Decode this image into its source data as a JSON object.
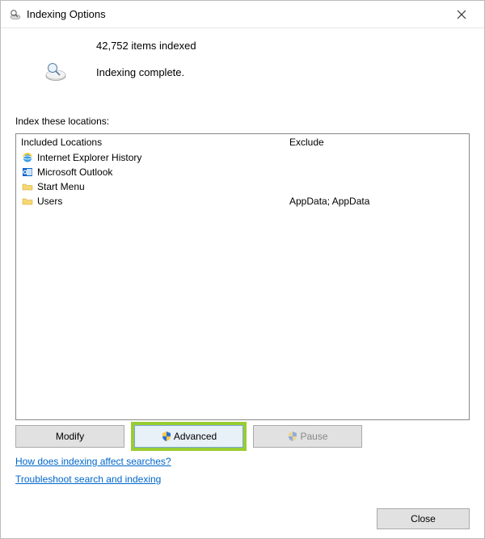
{
  "window": {
    "title": "Indexing Options"
  },
  "status": {
    "count_text": "42,752 items indexed",
    "status_text": "Indexing complete."
  },
  "section_label": "Index these locations:",
  "columns": {
    "included": "Included Locations",
    "exclude": "Exclude"
  },
  "locations": [
    {
      "icon": "ie",
      "label": "Internet Explorer History",
      "exclude": ""
    },
    {
      "icon": "outlook",
      "label": "Microsoft Outlook",
      "exclude": ""
    },
    {
      "icon": "folder",
      "label": "Start Menu",
      "exclude": ""
    },
    {
      "icon": "folder",
      "label": "Users",
      "exclude": "AppData; AppData"
    }
  ],
  "buttons": {
    "modify": "Modify",
    "advanced": "Advanced",
    "pause": "Pause",
    "close": "Close"
  },
  "links": {
    "how": "How does indexing affect searches?",
    "troubleshoot": "Troubleshoot search and indexing"
  }
}
